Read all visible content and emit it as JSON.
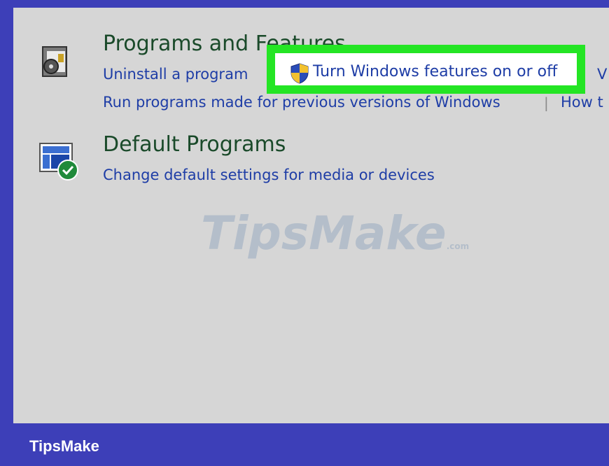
{
  "programs": {
    "title": "Programs and Features",
    "links": {
      "uninstall": "Uninstall a program",
      "turn_features": "Turn Windows features on or off",
      "view_truncated": "V",
      "run_old": "Run programs made for previous versions of Windows",
      "how_truncated": "How t"
    }
  },
  "default_programs": {
    "title": "Default Programs",
    "link": "Change default settings for media or devices"
  },
  "watermark": {
    "part1": "Tips",
    "part2": "Make",
    "domain": ".com"
  },
  "footer": {
    "brand": "TipsMake"
  },
  "colors": {
    "frame": "#3d3fb8",
    "panel": "#d6d6d6",
    "highlight": "#24e524",
    "link": "#1e3da6",
    "title": "#1a4a2a"
  }
}
